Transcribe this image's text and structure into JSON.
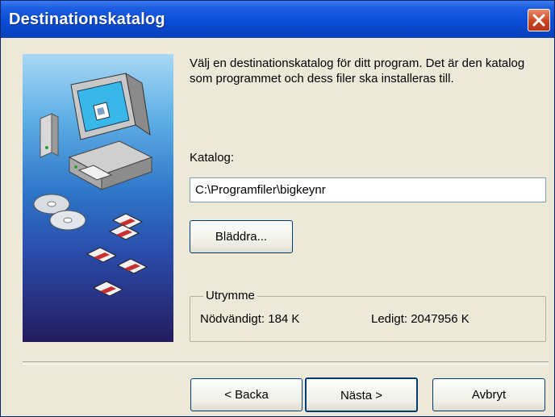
{
  "window": {
    "title": "Destinationskatalog",
    "close_icon": "close-icon",
    "accent": "#0a4fd8"
  },
  "side_image": {
    "icons": [
      "computer-icon",
      "cd-icon",
      "floppy-disk-icon"
    ]
  },
  "main": {
    "description": "Välj en destinationskatalog för ditt program. Det är den katalog som programmet och dess filer ska installeras till.",
    "folder_label": "Katalog:",
    "folder_value": "C:\\Programfiler\\bigkeynr",
    "browse_label": "Bläddra..."
  },
  "space": {
    "legend": "Utrymme",
    "required": "Nödvändigt: 184 K",
    "available": "Ledigt: 2047956 K"
  },
  "buttons": {
    "back": "< Backa",
    "next": "Nästa >",
    "cancel": "Avbryt"
  }
}
